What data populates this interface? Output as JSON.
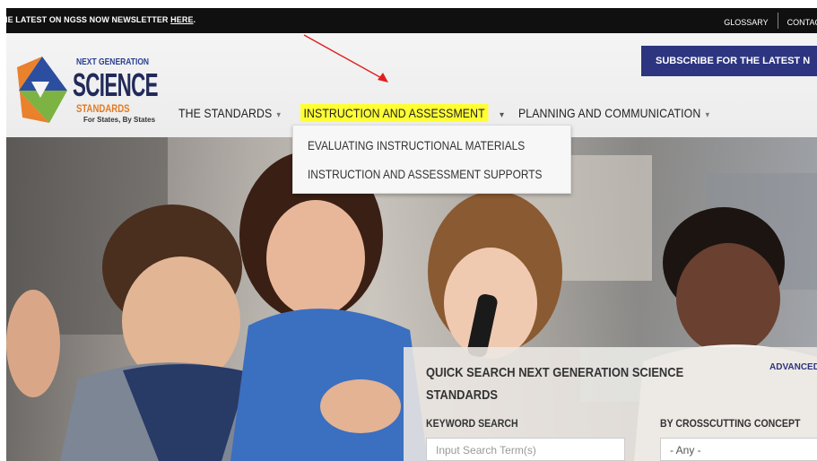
{
  "topbar": {
    "news_text": "HE LATEST ON NGSS NOW NEWSLETTER ",
    "news_link": "HERE",
    "news_suffix": ".",
    "glossary": "GLOSSARY",
    "contact": "CONTAC"
  },
  "logo": {
    "line1": "NEXT GENERATION",
    "line2": "SCIENCE",
    "line3": "STANDARDS",
    "tagline": "For States, By States"
  },
  "subscribe_label": "SUBSCRIBE FOR THE LATEST N",
  "nav": {
    "items": [
      {
        "label": "THE STANDARDS",
        "caret": "▾"
      },
      {
        "label": "INSTRUCTION AND ASSESSMENT",
        "caret": "▾"
      },
      {
        "label": "PLANNING AND COMMUNICATION",
        "caret": "▾"
      }
    ]
  },
  "dropdown": {
    "items": [
      "EVALUATING INSTRUCTIONAL MATERIALS",
      "INSTRUCTION AND ASSESSMENT SUPPORTS"
    ]
  },
  "search": {
    "title": "QUICK SEARCH NEXT GENERATION SCIENCE STANDARDS",
    "advanced": "ADVANCED",
    "keyword_label": "KEYWORD SEARCH",
    "crosscutting_label": "BY CROSSCUTTING CONCEPT",
    "input_placeholder": "Input Search Term(s)",
    "select_value": "- Any -"
  },
  "colors": {
    "topbar": "#101010",
    "brand_navy": "#2d3580",
    "highlight": "#ffff33",
    "annotation_arrow": "#e02020"
  }
}
